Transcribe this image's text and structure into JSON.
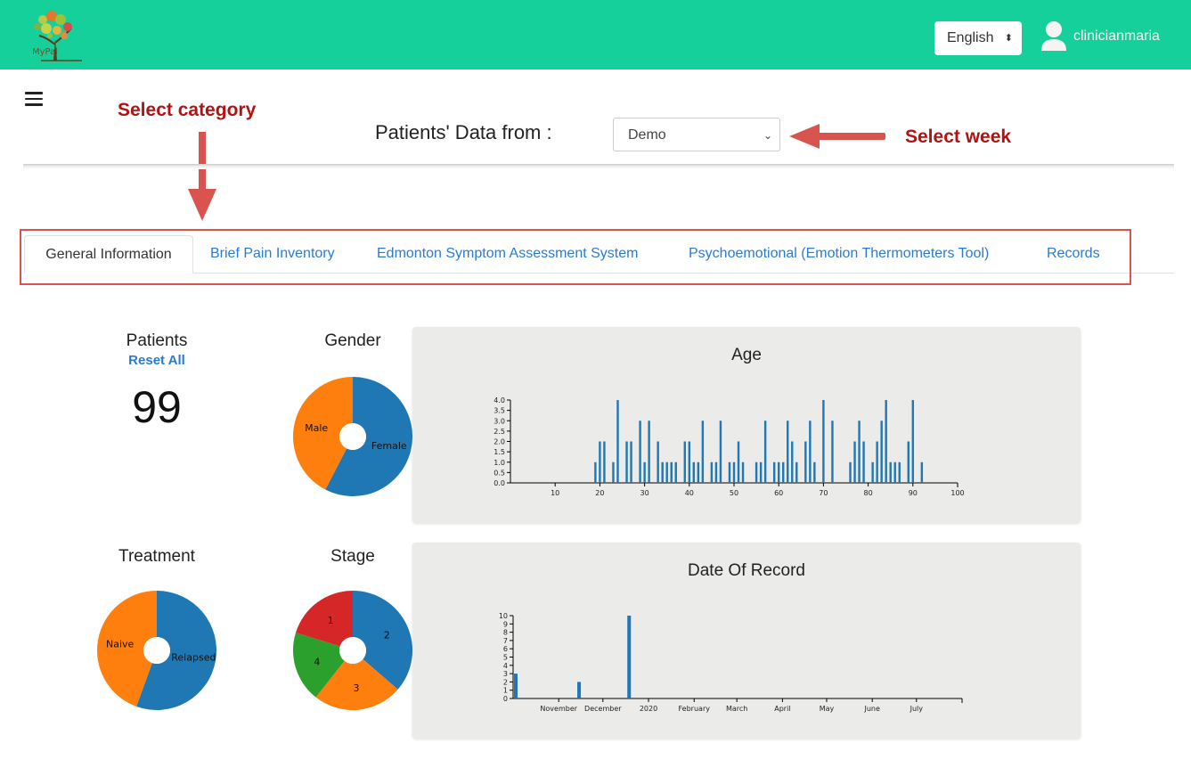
{
  "header": {
    "logo_text": "MyPal",
    "language": "English",
    "username": "clinicianmaria"
  },
  "annotations": {
    "select_category": "Select category",
    "select_week": "Select week"
  },
  "patients_data": {
    "label": "Patients' Data from :",
    "selected_week": "Demo"
  },
  "tabs": [
    {
      "label": "General Information"
    },
    {
      "label": "Brief Pain Inventory"
    },
    {
      "label": "Edmonton Symptom Assessment System"
    },
    {
      "label": "Psychoemotional (Emotion Thermometers Tool)"
    },
    {
      "label": "Records"
    }
  ],
  "patients": {
    "title": "Patients",
    "reset_label": "Reset All",
    "count": "99"
  },
  "colors": {
    "topbar": "#16d09c",
    "blue": "#1f77b4",
    "orange": "#ff7f0e",
    "green": "#2ca02c",
    "red": "#d62728",
    "annotation": "#b31212"
  },
  "chart_data": [
    {
      "type": "pie",
      "title": "Gender",
      "categories": [
        "Female",
        "Male"
      ],
      "values": [
        57,
        42
      ]
    },
    {
      "type": "pie",
      "title": "Treatment",
      "categories": [
        "Relapsed",
        "Naive"
      ],
      "values": [
        55,
        44
      ]
    },
    {
      "type": "pie",
      "title": "Stage",
      "categories": [
        "2",
        "3",
        "4",
        "1"
      ],
      "values": [
        36,
        24,
        19,
        20
      ]
    },
    {
      "type": "bar",
      "title": "Age",
      "x": [
        19,
        20,
        21,
        23,
        24,
        26,
        27,
        29,
        30,
        31,
        33,
        34,
        35,
        36,
        37,
        39,
        40,
        41,
        42,
        43,
        45,
        46,
        47,
        49,
        50,
        51,
        52,
        55,
        56,
        57,
        59,
        60,
        61,
        62,
        63,
        64,
        66,
        67,
        68,
        70,
        72,
        76,
        77,
        78,
        79,
        81,
        82,
        83,
        84,
        85,
        86,
        87,
        89,
        90,
        92
      ],
      "values": [
        1,
        2,
        2,
        1,
        4,
        2,
        2,
        3,
        1,
        3,
        2,
        1,
        1,
        1,
        1,
        2,
        2,
        1,
        1,
        3,
        1,
        1,
        3,
        1,
        1,
        2,
        1,
        1,
        1,
        3,
        1,
        1,
        1,
        3,
        2,
        1,
        2,
        3,
        1,
        4,
        3,
        1,
        2,
        3,
        2,
        1,
        2,
        3,
        4,
        1,
        1,
        1,
        2,
        4,
        1
      ],
      "xlim": [
        0,
        100
      ],
      "ylim": [
        0,
        4
      ],
      "xticks": [
        "10",
        "20",
        "30",
        "40",
        "50",
        "60",
        "70",
        "80",
        "90",
        "100"
      ],
      "yticks": [
        "0.0",
        "0.5",
        "1.0",
        "1.5",
        "2.0",
        "2.5",
        "3.0",
        "3.5",
        "4.0"
      ]
    },
    {
      "type": "bar",
      "title": "Date Of Record",
      "x": [
        "2019-10-01",
        "2019-11-13",
        "2019-12-17"
      ],
      "values": [
        3,
        2,
        10
      ],
      "xlim": [
        "2019-10-01",
        "2020-08-01"
      ],
      "ylim": [
        0,
        10
      ],
      "xticks": [
        "November",
        "December",
        "2020",
        "February",
        "March",
        "April",
        "May",
        "June",
        "July"
      ],
      "yticks": [
        "0",
        "1",
        "2",
        "3",
        "4",
        "5",
        "6",
        "7",
        "8",
        "9",
        "10"
      ]
    }
  ]
}
